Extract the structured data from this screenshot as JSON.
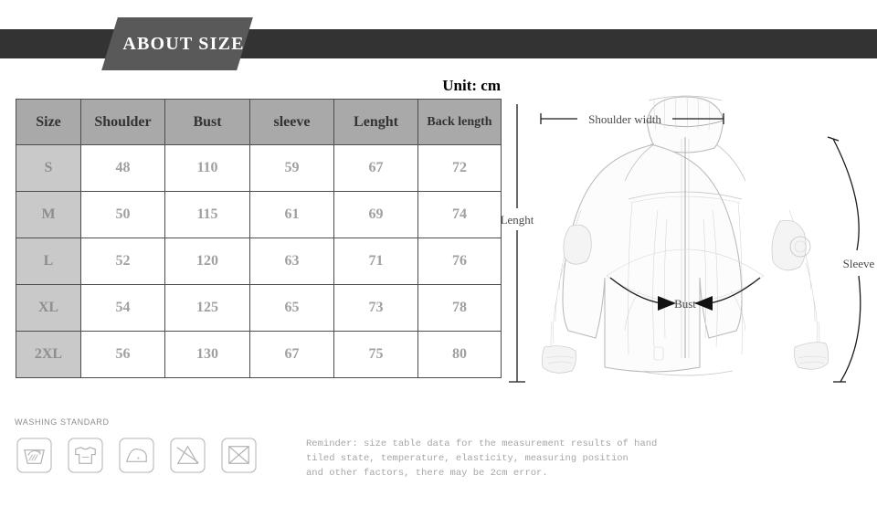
{
  "banner": {
    "title": "ABOUT SIZE"
  },
  "table": {
    "unit_label": "Unit: cm",
    "headers": [
      "Size",
      "Shoulder",
      "Bust",
      "sleeve",
      "Lenght",
      "Back length"
    ],
    "rows": [
      {
        "size": "S",
        "shoulder": "48",
        "bust": "110",
        "sleeve": "59",
        "lenght": "67",
        "back_length": "72"
      },
      {
        "size": "M",
        "shoulder": "50",
        "bust": "115",
        "sleeve": "61",
        "lenght": "69",
        "back_length": "74"
      },
      {
        "size": "L",
        "shoulder": "52",
        "bust": "120",
        "sleeve": "63",
        "lenght": "71",
        "back_length": "76"
      },
      {
        "size": "XL",
        "shoulder": "54",
        "bust": "125",
        "sleeve": "65",
        "lenght": "73",
        "back_length": "78"
      },
      {
        "size": "2XL",
        "shoulder": "56",
        "bust": "130",
        "sleeve": "67",
        "lenght": "75",
        "back_length": "80"
      }
    ]
  },
  "washing": {
    "title": "WASHING STANDARD",
    "icons": [
      {
        "name": "hand-wash-icon",
        "label": "Hand wash"
      },
      {
        "name": "dry-flat-icon",
        "label": "Dry flat"
      },
      {
        "name": "iron-low-heat-icon",
        "label": "Iron low heat"
      },
      {
        "name": "do-not-bleach-icon",
        "label": "Do not bleach"
      },
      {
        "name": "do-not-tumble-dry-icon",
        "label": "Do not tumble dry"
      }
    ]
  },
  "reminder": {
    "text": "Reminder: size table data for the measurement results of hand\ntiled state, temperature, elasticity, measuring position\nand other factors, there may be 2cm error."
  },
  "diagram": {
    "labels": {
      "shoulder_width": "Shoulder width",
      "lenght": "Lenght",
      "bust": "Bust",
      "sleeve": "Sleeve"
    }
  },
  "colors": {
    "banner_stripe": "#333333",
    "banner_tab": "#595959",
    "header_cell": "#a9a9a9",
    "size_cell": "#c9c9c9",
    "value_text": "#a0a0a0",
    "page_background": "#ffffff"
  }
}
